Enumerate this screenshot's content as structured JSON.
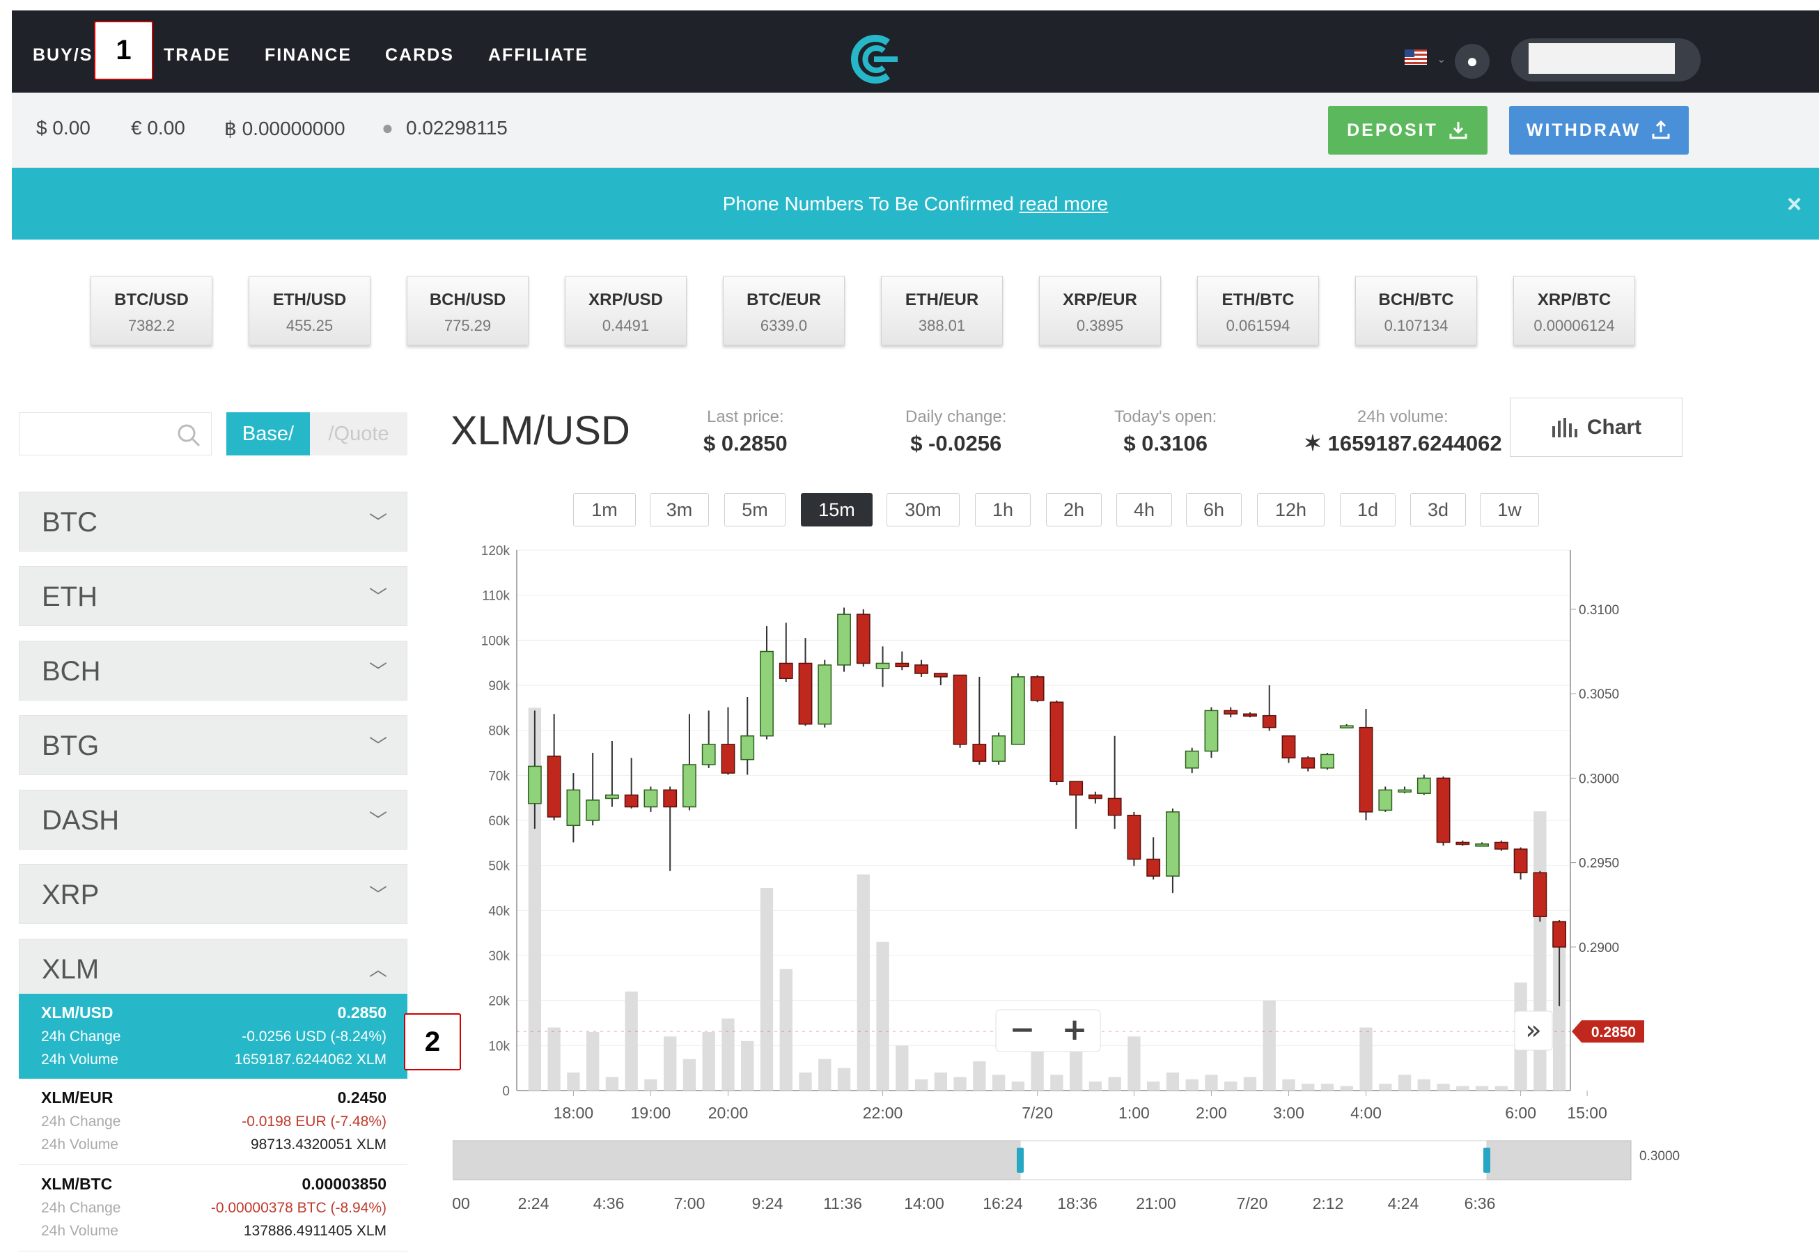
{
  "nav": {
    "items": [
      "BUY/S",
      "TRADE",
      "FINANCE",
      "CARDS",
      "AFFILIATE"
    ]
  },
  "balances": {
    "usd": "$ 0.00",
    "eur": "€ 0.00",
    "btc": "฿ 0.00000000",
    "other": "0.02298115",
    "deposit_label": "DEPOSIT",
    "withdraw_label": "WITHDRAW"
  },
  "banner": {
    "text": "Phone Numbers To Be Confirmed ",
    "link": "read more",
    "close": "×"
  },
  "tickers": [
    {
      "pair": "BTC/USD",
      "price": "7382.2"
    },
    {
      "pair": "ETH/USD",
      "price": "455.25"
    },
    {
      "pair": "BCH/USD",
      "price": "775.29"
    },
    {
      "pair": "XRP/USD",
      "price": "0.4491"
    },
    {
      "pair": "BTC/EUR",
      "price": "6339.0"
    },
    {
      "pair": "ETH/EUR",
      "price": "388.01"
    },
    {
      "pair": "XRP/EUR",
      "price": "0.3895"
    },
    {
      "pair": "ETH/BTC",
      "price": "0.061594"
    },
    {
      "pair": "BCH/BTC",
      "price": "0.107134"
    },
    {
      "pair": "XRP/BTC",
      "price": "0.00006124"
    }
  ],
  "sidebar": {
    "base_label": "Base/",
    "quote_label": "/Quote",
    "groups": [
      "BTC",
      "ETH",
      "BCH",
      "BTG",
      "DASH",
      "XRP",
      "XLM"
    ],
    "pairs": [
      {
        "name": "XLM/USD",
        "price": "0.2850",
        "change_label": "24h Change",
        "change": "-0.0256 USD (-8.24%)",
        "volume_label": "24h Volume",
        "volume": "1659187.6244062 XLM"
      },
      {
        "name": "XLM/EUR",
        "price": "0.2450",
        "change_label": "24h Change",
        "change": "-0.0198 EUR (-7.48%)",
        "volume_label": "24h Volume",
        "volume": "98713.4320051 XLM"
      },
      {
        "name": "XLM/BTC",
        "price": "0.00003850",
        "change_label": "24h Change",
        "change": "-0.00000378 BTC (-8.94%)",
        "volume_label": "24h Volume",
        "volume": "137886.4911405 XLM"
      }
    ]
  },
  "market": {
    "pair": "XLM/USD",
    "last_price_label": "Last price:",
    "last_price": "$ 0.2850",
    "daily_change_label": "Daily change:",
    "daily_change": "$ -0.0256",
    "open_label": "Today's open:",
    "open": "$ 0.3106",
    "volume_label": "24h volume:",
    "volume": "✶ 1659187.6244062",
    "chart_button": "Chart"
  },
  "timeframes": {
    "options": [
      "1m",
      "3m",
      "5m",
      "15m",
      "30m",
      "1h",
      "2h",
      "4h",
      "6h",
      "12h",
      "1d",
      "3d",
      "1w"
    ],
    "selected": "15m"
  },
  "annotations": [
    "1",
    "2"
  ],
  "chart_data": {
    "type": "candlestick",
    "y_volume_ticks": [
      "0",
      "10k",
      "20k",
      "30k",
      "40k",
      "50k",
      "60k",
      "70k",
      "80k",
      "90k",
      "100k",
      "110k",
      "120k"
    ],
    "y_price_ticks": [
      "0.3100",
      "0.3050",
      "0.3000",
      "0.2950",
      "0.2900"
    ],
    "x_ticks": [
      "18:00",
      "19:00",
      "20:00",
      "22:00",
      "7/20",
      "1:00",
      "2:00",
      "3:00",
      "4:00",
      "6:00",
      "15:00"
    ],
    "ylim_volume": [
      0,
      120000
    ],
    "ylim_price": [
      0.2815,
      0.3135
    ],
    "current_price_label": "0.2850",
    "zoom_out": "−",
    "zoom_in": "+",
    "expand": "»",
    "navigator_x_ticks": [
      "00",
      "2:24",
      "4:36",
      "7:00",
      "9:24",
      "11:36",
      "14:00",
      "16:24",
      "18:36",
      "21:00",
      "7/20",
      "2:12",
      "4:24",
      "6:36"
    ],
    "navigator_price_label": "0.3000",
    "candles": [
      {
        "o": 0.2985,
        "c": 0.3007,
        "h": 0.304,
        "l": 0.297,
        "v": 85000
      },
      {
        "o": 0.3013,
        "c": 0.2977,
        "h": 0.3038,
        "l": 0.2975,
        "v": 14000
      },
      {
        "o": 0.2972,
        "c": 0.2993,
        "h": 0.3003,
        "l": 0.2962,
        "v": 4000
      },
      {
        "o": 0.2975,
        "c": 0.2987,
        "h": 0.3015,
        "l": 0.2972,
        "v": 13000
      },
      {
        "o": 0.2988,
        "c": 0.299,
        "h": 0.3022,
        "l": 0.2983,
        "v": 3000
      },
      {
        "o": 0.299,
        "c": 0.2983,
        "h": 0.3012,
        "l": 0.2982,
        "v": 22000
      },
      {
        "o": 0.2983,
        "c": 0.2993,
        "h": 0.2995,
        "l": 0.298,
        "v": 2500
      },
      {
        "o": 0.2993,
        "c": 0.2983,
        "h": 0.2995,
        "l": 0.2945,
        "v": 12000
      },
      {
        "o": 0.2983,
        "c": 0.3008,
        "h": 0.3038,
        "l": 0.2981,
        "v": 7000
      },
      {
        "o": 0.3008,
        "c": 0.302,
        "h": 0.304,
        "l": 0.3006,
        "v": 13000
      },
      {
        "o": 0.302,
        "c": 0.3003,
        "h": 0.3042,
        "l": 0.3002,
        "v": 16000
      },
      {
        "o": 0.3011,
        "c": 0.3025,
        "h": 0.3048,
        "l": 0.3002,
        "v": 11000
      },
      {
        "o": 0.3025,
        "c": 0.3075,
        "h": 0.309,
        "l": 0.3023,
        "v": 45000
      },
      {
        "o": 0.3068,
        "c": 0.3059,
        "h": 0.3092,
        "l": 0.3057,
        "v": 27000
      },
      {
        "o": 0.3068,
        "c": 0.3032,
        "h": 0.3083,
        "l": 0.3031,
        "v": 4000
      },
      {
        "o": 0.3032,
        "c": 0.3067,
        "h": 0.307,
        "l": 0.303,
        "v": 7000
      },
      {
        "o": 0.3067,
        "c": 0.3097,
        "h": 0.3101,
        "l": 0.3063,
        "v": 5000
      },
      {
        "o": 0.3097,
        "c": 0.3068,
        "h": 0.31,
        "l": 0.3066,
        "v": 48000
      },
      {
        "o": 0.3065,
        "c": 0.3068,
        "h": 0.3078,
        "l": 0.3054,
        "v": 33000
      },
      {
        "o": 0.3068,
        "c": 0.3066,
        "h": 0.3075,
        "l": 0.3064,
        "v": 10000
      },
      {
        "o": 0.3067,
        "c": 0.3062,
        "h": 0.307,
        "l": 0.306,
        "v": 2500
      },
      {
        "o": 0.3062,
        "c": 0.306,
        "h": 0.3062,
        "l": 0.3055,
        "v": 4000
      },
      {
        "o": 0.3061,
        "c": 0.302,
        "h": 0.3061,
        "l": 0.3018,
        "v": 3000
      },
      {
        "o": 0.302,
        "c": 0.301,
        "h": 0.306,
        "l": 0.3008,
        "v": 6500
      },
      {
        "o": 0.301,
        "c": 0.3025,
        "h": 0.3027,
        "l": 0.3008,
        "v": 3500
      },
      {
        "o": 0.302,
        "c": 0.306,
        "h": 0.3062,
        "l": 0.302,
        "v": 2000
      },
      {
        "o": 0.306,
        "c": 0.3046,
        "h": 0.3061,
        "l": 0.3045,
        "v": 11000
      },
      {
        "o": 0.3045,
        "c": 0.2998,
        "h": 0.3046,
        "l": 0.2996,
        "v": 3500
      },
      {
        "o": 0.2998,
        "c": 0.299,
        "h": 0.2998,
        "l": 0.297,
        "v": 10000
      },
      {
        "o": 0.299,
        "c": 0.2988,
        "h": 0.2992,
        "l": 0.2985,
        "v": 2000
      },
      {
        "o": 0.2988,
        "c": 0.2978,
        "h": 0.3025,
        "l": 0.297,
        "v": 3000
      },
      {
        "o": 0.2978,
        "c": 0.2952,
        "h": 0.298,
        "l": 0.2948,
        "v": 12000
      },
      {
        "o": 0.2952,
        "c": 0.2942,
        "h": 0.2965,
        "l": 0.294,
        "v": 2000
      },
      {
        "o": 0.2942,
        "c": 0.298,
        "h": 0.2982,
        "l": 0.2932,
        "v": 4000
      },
      {
        "o": 0.3006,
        "c": 0.3016,
        "h": 0.3018,
        "l": 0.3003,
        "v": 2500
      },
      {
        "o": 0.3016,
        "c": 0.304,
        "h": 0.3042,
        "l": 0.3012,
        "v": 3500
      },
      {
        "o": 0.304,
        "c": 0.3038,
        "h": 0.3042,
        "l": 0.3036,
        "v": 2000
      },
      {
        "o": 0.3038,
        "c": 0.3037,
        "h": 0.3039,
        "l": 0.3036,
        "v": 3000
      },
      {
        "o": 0.3037,
        "c": 0.303,
        "h": 0.3055,
        "l": 0.3028,
        "v": 20000
      },
      {
        "o": 0.3025,
        "c": 0.3012,
        "h": 0.3025,
        "l": 0.3009,
        "v": 2500
      },
      {
        "o": 0.3012,
        "c": 0.3006,
        "h": 0.3013,
        "l": 0.3004,
        "v": 1500
      },
      {
        "o": 0.3006,
        "c": 0.3014,
        "h": 0.3015,
        "l": 0.3005,
        "v": 1500
      },
      {
        "o": 0.3031,
        "c": 0.3031,
        "h": 0.3032,
        "l": 0.303,
        "v": 1000
      },
      {
        "o": 0.303,
        "c": 0.298,
        "h": 0.3041,
        "l": 0.2975,
        "v": 14000
      },
      {
        "o": 0.2981,
        "c": 0.2993,
        "h": 0.2995,
        "l": 0.298,
        "v": 1500
      },
      {
        "o": 0.2993,
        "c": 0.2993,
        "h": 0.2995,
        "l": 0.2991,
        "v": 3500
      },
      {
        "o": 0.2991,
        "c": 0.3,
        "h": 0.3002,
        "l": 0.299,
        "v": 2500
      },
      {
        "o": 0.3,
        "c": 0.2962,
        "h": 0.3001,
        "l": 0.296,
        "v": 1500
      },
      {
        "o": 0.2962,
        "c": 0.2961,
        "h": 0.2963,
        "l": 0.296,
        "v": 1000
      },
      {
        "o": 0.2961,
        "c": 0.2961,
        "h": 0.2962,
        "l": 0.296,
        "v": 1000
      },
      {
        "o": 0.2962,
        "c": 0.2958,
        "h": 0.2963,
        "l": 0.2957,
        "v": 1000
      },
      {
        "o": 0.2958,
        "c": 0.2944,
        "h": 0.2959,
        "l": 0.294,
        "v": 24000
      },
      {
        "o": 0.2944,
        "c": 0.2918,
        "h": 0.2945,
        "l": 0.2915,
        "v": 62000
      },
      {
        "o": 0.2915,
        "c": 0.29,
        "h": 0.2916,
        "l": 0.2865,
        "v": 32000
      }
    ]
  }
}
